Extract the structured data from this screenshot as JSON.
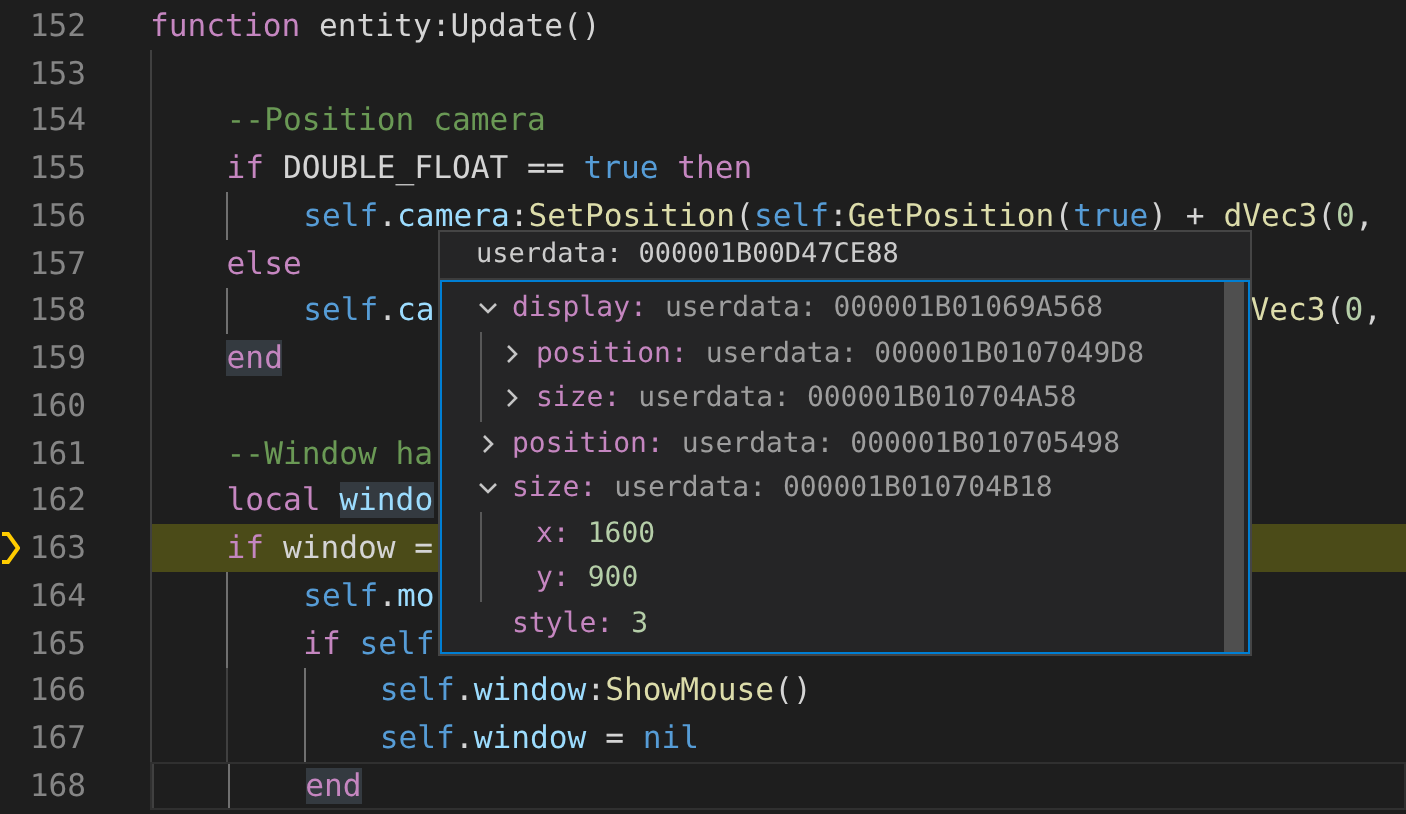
{
  "editor": {
    "lines": [
      {
        "number": "152",
        "tokens": [
          {
            "kind": "keyword",
            "text": "function"
          },
          {
            "kind": "plain",
            "text": " entity:Update()"
          }
        ],
        "children": [
          {
            "number": "153"
          },
          {
            "number": "154",
            "tokens": [
              {
                "kind": "comment",
                "text": "--Position camera"
              }
            ]
          },
          {
            "number": "155",
            "tokens": [
              {
                "kind": "keyword",
                "text": "if"
              },
              {
                "kind": "plain",
                "text": " DOUBLE_FLOAT == "
              },
              {
                "kind": "constant",
                "text": "true"
              },
              {
                "kind": "keyword",
                "text": " then"
              }
            ],
            "children": [
              {
                "number": "156",
                "tokens": [
                  {
                    "kind": "self",
                    "text": "self"
                  },
                  {
                    "kind": "plain",
                    "text": "."
                  },
                  {
                    "kind": "variable",
                    "text": "camera"
                  },
                  {
                    "kind": "plain",
                    "text": ":"
                  },
                  {
                    "kind": "function",
                    "text": "SetPosition"
                  },
                  {
                    "kind": "plain",
                    "text": "("
                  },
                  {
                    "kind": "self",
                    "text": "self"
                  },
                  {
                    "kind": "plain",
                    "text": ":"
                  },
                  {
                    "kind": "function",
                    "text": "GetPosition"
                  },
                  {
                    "kind": "plain",
                    "text": "("
                  },
                  {
                    "kind": "constant",
                    "text": "true"
                  },
                  {
                    "kind": "plain",
                    "text": ") + "
                  },
                  {
                    "kind": "function",
                    "text": "dVec3"
                  },
                  {
                    "kind": "plain",
                    "text": "("
                  },
                  {
                    "kind": "number",
                    "text": "0"
                  },
                  {
                    "kind": "plain",
                    "text": ","
                  }
                ]
              }
            ]
          },
          {
            "number": "157",
            "tokens": [
              {
                "kind": "keyword",
                "text": "else"
              }
            ],
            "children": [
              {
                "number": "158",
                "tokens": [
                  {
                    "kind": "self",
                    "text": "self"
                  },
                  {
                    "kind": "plain",
                    "text": "."
                  },
                  {
                    "kind": "variable",
                    "text": "ca"
                  }
                ],
                "tail": [
                  {
                    "kind": "function",
                    "text": "Vec3"
                  },
                  {
                    "kind": "plain",
                    "text": "("
                  },
                  {
                    "kind": "number",
                    "text": "0"
                  },
                  {
                    "kind": "plain",
                    "text": ","
                  }
                ]
              }
            ]
          },
          {
            "number": "159",
            "tokens": [
              {
                "kind": "keyword",
                "text": "end",
                "matched": true
              }
            ]
          },
          {
            "number": "160"
          },
          {
            "number": "161",
            "tokens": [
              {
                "kind": "comment",
                "text": "--Window ha"
              }
            ]
          },
          {
            "number": "162",
            "tokens": [
              {
                "kind": "keyword",
                "text": "local "
              },
              {
                "kind": "variable",
                "text": "windo",
                "matched": true
              }
            ]
          },
          {
            "number": "163",
            "current": true,
            "tokens": [
              {
                "kind": "keyword",
                "text": "if"
              },
              {
                "kind": "plain",
                "text": " window ="
              }
            ],
            "children": [
              {
                "number": "164",
                "tokens": [
                  {
                    "kind": "self",
                    "text": "self"
                  },
                  {
                    "kind": "plain",
                    "text": "."
                  },
                  {
                    "kind": "variable",
                    "text": "mo"
                  }
                ]
              },
              {
                "number": "165",
                "tokens": [
                  {
                    "kind": "keyword",
                    "text": "if "
                  },
                  {
                    "kind": "self",
                    "text": "self"
                  }
                ],
                "children": [
                  {
                    "number": "166",
                    "tokens": [
                      {
                        "kind": "self",
                        "text": "self"
                      },
                      {
                        "kind": "plain",
                        "text": "."
                      },
                      {
                        "kind": "variable",
                        "text": "window"
                      },
                      {
                        "kind": "plain",
                        "text": ":"
                      },
                      {
                        "kind": "function",
                        "text": "ShowMouse"
                      },
                      {
                        "kind": "plain",
                        "text": "()"
                      }
                    ]
                  },
                  {
                    "number": "167",
                    "tokens": [
                      {
                        "kind": "self",
                        "text": "self"
                      },
                      {
                        "kind": "plain",
                        "text": "."
                      },
                      {
                        "kind": "variable",
                        "text": "window"
                      },
                      {
                        "kind": "plain",
                        "text": " = "
                      },
                      {
                        "kind": "constant",
                        "text": "nil"
                      }
                    ]
                  }
                ]
              },
              {
                "number": "168",
                "cursor": true,
                "tokens": [
                  {
                    "kind": "keyword",
                    "text": "end",
                    "matched": true
                  }
                ]
              }
            ]
          }
        ]
      }
    ]
  },
  "hover": {
    "title": "userdata: 000001B00D47CE88",
    "items": [
      {
        "key": "display:",
        "value": "userdata: 000001B01069A568",
        "kind": "userdata",
        "expanded": true,
        "children": [
          {
            "key": "position:",
            "value": "userdata: 000001B0107049D8",
            "kind": "userdata",
            "expanded": false
          },
          {
            "key": "size:",
            "value": "userdata: 000001B010704A58",
            "kind": "userdata",
            "expanded": false
          }
        ]
      },
      {
        "key": "position:",
        "value": "userdata: 000001B010705498",
        "kind": "userdata",
        "expanded": false
      },
      {
        "key": "size:",
        "value": "userdata: 000001B010704B18",
        "kind": "userdata",
        "expanded": true,
        "children": [
          {
            "key": "x:",
            "value": "1600",
            "kind": "number"
          },
          {
            "key": "y:",
            "value": "900",
            "kind": "number"
          }
        ]
      },
      {
        "key": "style:",
        "value": "3",
        "kind": "number"
      }
    ]
  }
}
